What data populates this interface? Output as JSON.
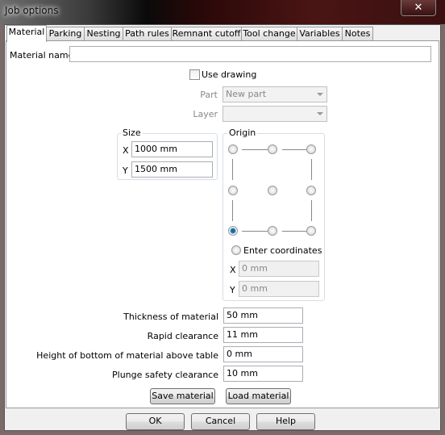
{
  "window": {
    "title": "Job options",
    "close_icon": "close-icon"
  },
  "tabs": [
    {
      "label": "Material",
      "active": true
    },
    {
      "label": "Parking"
    },
    {
      "label": "Nesting"
    },
    {
      "label": "Path rules"
    },
    {
      "label": "Remnant cutoff"
    },
    {
      "label": "Tool change"
    },
    {
      "label": "Variables"
    },
    {
      "label": "Notes"
    }
  ],
  "material": {
    "name_label": "Material name",
    "name_value": "",
    "use_drawing_label": "Use drawing",
    "use_drawing_checked": false,
    "part_label": "Part",
    "part_value": "New part",
    "layer_label": "Layer",
    "layer_value": "",
    "size": {
      "legend": "Size",
      "x_label": "X",
      "x_value": "1000 mm",
      "y_label": "Y",
      "y_value": "1500 mm"
    },
    "origin": {
      "legend": "Origin",
      "selected": "bottom-left",
      "enter_coords_label": "Enter coordinates",
      "x_label": "X",
      "x_value": "0 mm",
      "y_label": "Y",
      "y_value": "0 mm"
    },
    "thickness_label": "Thickness of material",
    "thickness_value": "50 mm",
    "rapid_label": "Rapid clearance",
    "rapid_value": "11 mm",
    "height_label": "Height of bottom of material above table",
    "height_value": "0 mm",
    "plunge_label": "Plunge safety clearance",
    "plunge_value": "10 mm",
    "save_label": "Save material",
    "load_label": "Load material"
  },
  "footer": {
    "ok": "OK",
    "cancel": "Cancel",
    "help": "Help"
  }
}
